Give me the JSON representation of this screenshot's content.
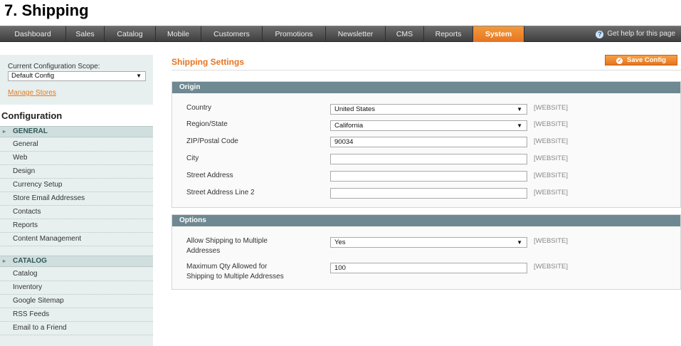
{
  "page_heading": "7. Shipping",
  "nav": {
    "items": [
      "Dashboard",
      "Sales",
      "Catalog",
      "Mobile",
      "Customers",
      "Promotions",
      "Newsletter",
      "CMS",
      "Reports",
      "System"
    ],
    "active": "System",
    "help": "Get help for this page"
  },
  "sidebar": {
    "scope_label": "Current Configuration Scope:",
    "scope_value": "Default Config",
    "manage_stores": "Manage Stores",
    "config_title": "Configuration",
    "groups": [
      {
        "label": "GENERAL",
        "items": [
          "General",
          "Web",
          "Design",
          "Currency Setup",
          "Store Email Addresses",
          "Contacts",
          "Reports",
          "Content Management"
        ]
      },
      {
        "label": "CATALOG",
        "items": [
          "Catalog",
          "Inventory",
          "Google Sitemap",
          "RSS Feeds",
          "Email to a Friend"
        ]
      }
    ]
  },
  "main": {
    "title": "Shipping Settings",
    "save_label": "Save Config",
    "origin": {
      "header": "Origin",
      "rows": [
        {
          "label": "Country",
          "value": "United States",
          "type": "select",
          "scope": "[WEBSITE]"
        },
        {
          "label": "Region/State",
          "value": "California",
          "type": "select",
          "scope": "[WEBSITE]"
        },
        {
          "label": "ZIP/Postal Code",
          "value": "90034",
          "type": "text",
          "scope": "[WEBSITE]"
        },
        {
          "label": "City",
          "value": "",
          "type": "text",
          "scope": "[WEBSITE]"
        },
        {
          "label": "Street Address",
          "value": "",
          "type": "text",
          "scope": "[WEBSITE]"
        },
        {
          "label": "Street Address Line 2",
          "value": "",
          "type": "text",
          "scope": "[WEBSITE]"
        }
      ]
    },
    "options": {
      "header": "Options",
      "rows": [
        {
          "label_line1": "Allow Shipping to Multiple",
          "label_line2": "Addresses",
          "value": "Yes",
          "type": "select",
          "scope": "[WEBSITE]"
        },
        {
          "label_line1": "Maximum Qty Allowed for",
          "label_line2": "Shipping to Multiple Addresses",
          "value": "100",
          "type": "text",
          "scope": "[WEBSITE]"
        }
      ]
    }
  }
}
